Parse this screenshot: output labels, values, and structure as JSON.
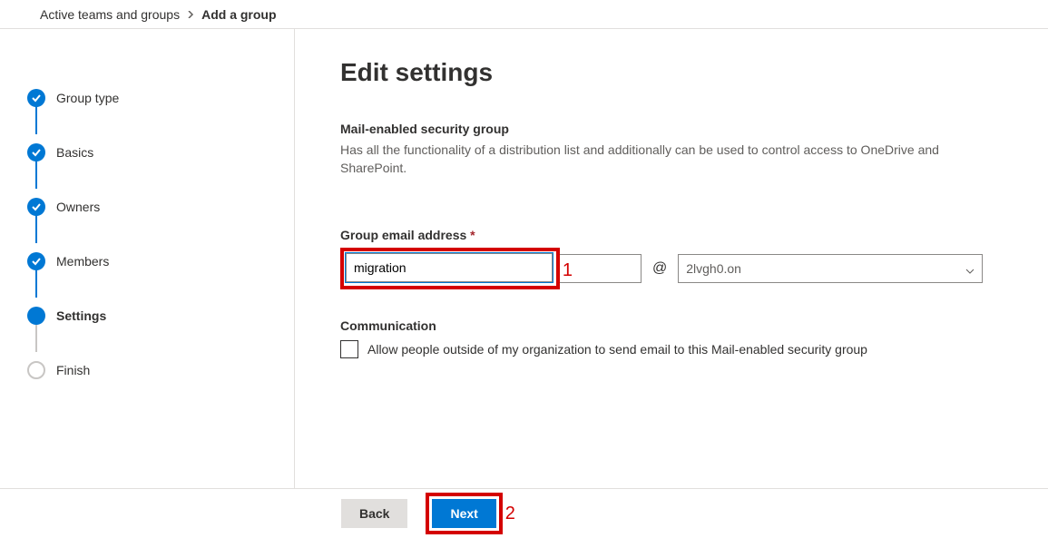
{
  "breadcrumb": {
    "parent": "Active teams and groups",
    "current": "Add a group"
  },
  "stepper": {
    "steps": [
      {
        "label": "Group type",
        "state": "done"
      },
      {
        "label": "Basics",
        "state": "done"
      },
      {
        "label": "Owners",
        "state": "done"
      },
      {
        "label": "Members",
        "state": "done"
      },
      {
        "label": "Settings",
        "state": "current"
      },
      {
        "label": "Finish",
        "state": "pending"
      }
    ]
  },
  "content": {
    "title": "Edit settings",
    "subhead": "Mail-enabled security group",
    "description": "Has all the functionality of a distribution list and additionally can be used to control access to OneDrive and SharePoint.",
    "email_label": "Group email address",
    "email_value": "migration",
    "at_symbol": "@",
    "domain_value": "2lvgh0.on",
    "communication_heading": "Communication",
    "checkbox_label": "Allow people outside of my organization to send email to this Mail-enabled security group"
  },
  "footer": {
    "back": "Back",
    "next": "Next"
  },
  "annotations": {
    "email_callout": "1",
    "next_callout": "2"
  }
}
